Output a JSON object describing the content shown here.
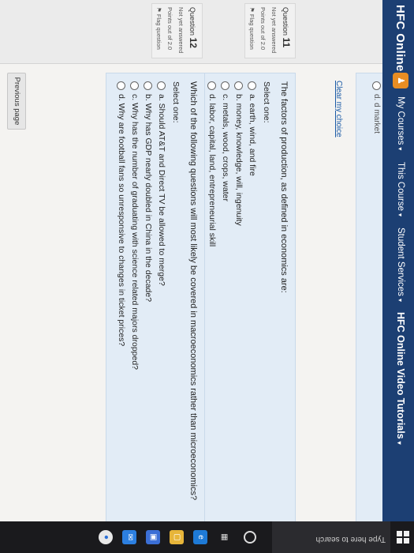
{
  "navbar": {
    "brand": "HFC Online",
    "icon": "user-group-icon",
    "items": [
      {
        "label": "My Courses",
        "caret": "▾"
      },
      {
        "label": "This Course",
        "caret": "▾"
      },
      {
        "label": "Student Services",
        "caret": "▾"
      },
      {
        "label": "HFC Online Video Tutorials",
        "caret": "▾"
      }
    ]
  },
  "previous_question": {
    "last_option": "d. d market",
    "clear_label": "Clear my choice"
  },
  "questions": [
    {
      "label": "Question",
      "number": "11",
      "status": "Not yet answered",
      "points": "Points out of 2.0",
      "flag": "Flag question",
      "text": "The factors of production, as defined in economics are:",
      "select_label": "Select one:",
      "options": [
        "a. earth, wind, and fire",
        "b. money, knowledge, will, ingenuity",
        "c. metals, wood, crops, water",
        "d. labor, capital, land, entrepreneurial skill"
      ]
    },
    {
      "label": "Question",
      "number": "12",
      "status": "Not yet answered",
      "points": "Points out of 2.0",
      "flag": "Flag question",
      "text": "Which of the following questions will most likely be covered in macroeconomics rather than microeconomics?",
      "select_label": "Select one:",
      "options": [
        "a. Should AT&T and Direct TV be allowed to merge?",
        "b. Why has GDP nearly doubled in China in the decade?",
        "c. Why has the number of graduating with science related majors dropped?",
        "d. Why are football fans so unresponsive to changes in ticket prices?"
      ]
    }
  ],
  "footer": {
    "previous_page": "Previous page"
  },
  "taskbar": {
    "search_placeholder": "Type here to search",
    "icons": [
      "windows-start-icon",
      "cortana-icon",
      "task-view-icon",
      "edge-icon",
      "file-explorer-icon",
      "store-icon",
      "mail-icon",
      "chrome-icon"
    ]
  }
}
